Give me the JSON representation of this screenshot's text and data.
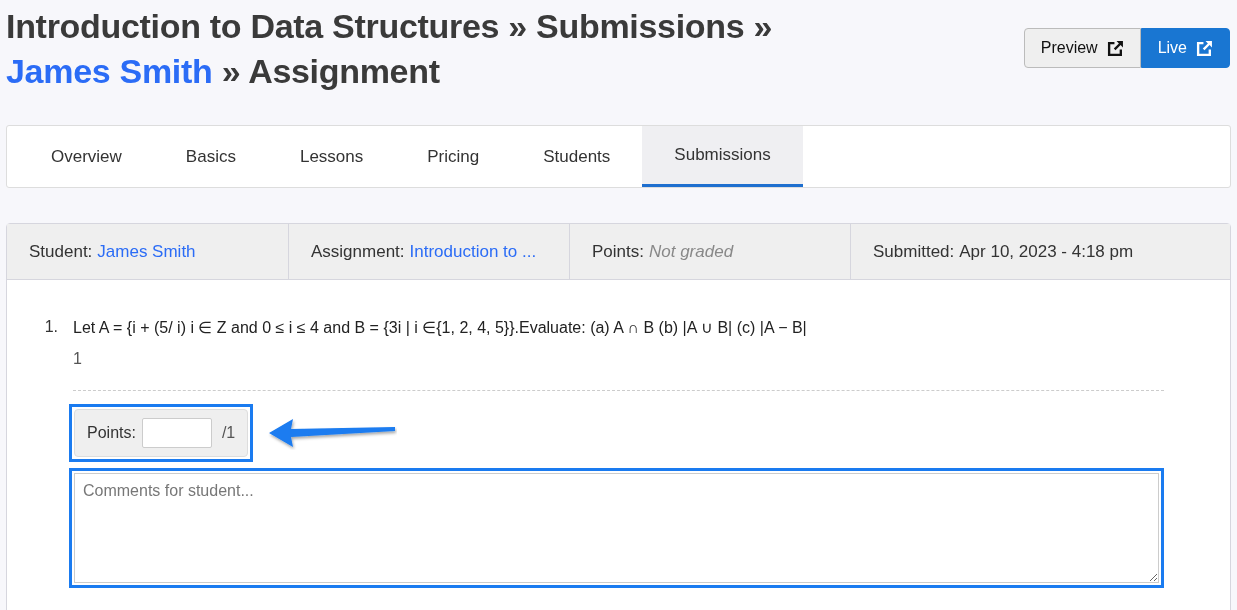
{
  "title": {
    "crumbs": [
      {
        "text": "Introduction to Data Structures",
        "kind": "plain"
      },
      {
        "text": "»",
        "kind": "separator"
      },
      {
        "text": "Submissions",
        "kind": "plain"
      },
      {
        "text": "»",
        "kind": "separator"
      },
      {
        "text": "James Smith",
        "kind": "link"
      },
      {
        "text": "»",
        "kind": "separator"
      },
      {
        "text": "Assignment",
        "kind": "plain"
      }
    ]
  },
  "header_buttons": [
    {
      "label": "Preview",
      "primary": false
    },
    {
      "label": "Live",
      "primary": true
    }
  ],
  "tabs": [
    {
      "label": "Overview",
      "selected": false
    },
    {
      "label": "Basics",
      "selected": false
    },
    {
      "label": "Lessons",
      "selected": false
    },
    {
      "label": "Pricing",
      "selected": false
    },
    {
      "label": "Students",
      "selected": false
    },
    {
      "label": "Submissions",
      "selected": true
    }
  ],
  "info": [
    {
      "label": "Student:",
      "value": "James Smith",
      "kind": "link"
    },
    {
      "label": "Assignment:",
      "value": "Introduction to ...",
      "kind": "link"
    },
    {
      "label": "Points:",
      "value": "Not graded",
      "kind": "muted"
    },
    {
      "label": "Submitted:",
      "value": "Apr 10, 2023 - 4:18 pm",
      "kind": "plain"
    }
  ],
  "questions": [
    {
      "number": "1.",
      "text": "Let A = {i + (5/ i)  i ∈ Z and 0 ≤ i ≤ 4 and B = {3i | i ∈{1, 2, 4, 5}}.Evaluate: (a) A ∩ B (b) |A ∪ B| (c) |A − B|",
      "answer": "1"
    }
  ],
  "grading": {
    "points_label": "Points:",
    "points_total": "/1",
    "points_highlighted": true,
    "comment_placeholder": "Comments for student...",
    "comment_highlighted": true
  }
}
